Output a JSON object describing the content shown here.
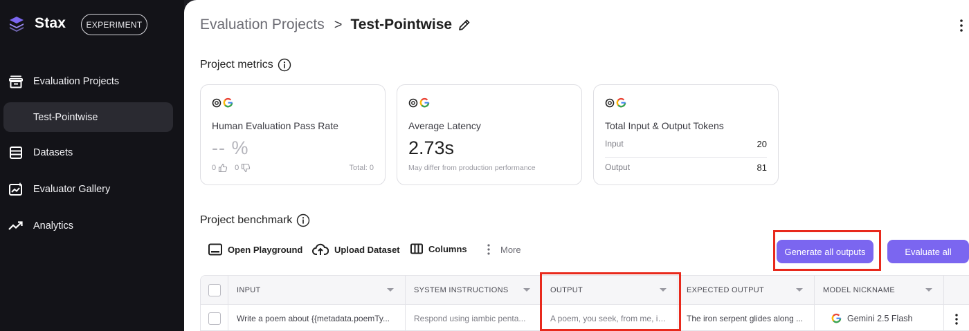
{
  "app": {
    "name": "Stax",
    "badge": "EXPERIMENT"
  },
  "sidebar": {
    "items": [
      {
        "label": "Evaluation Projects",
        "icon": "archive-icon"
      },
      {
        "label": "Test-Pointwise",
        "icon": "",
        "active": true
      },
      {
        "label": "Datasets",
        "icon": "table-icon"
      },
      {
        "label": "Evaluator Gallery",
        "icon": "gallery-chart-icon"
      },
      {
        "label": "Analytics",
        "icon": "trending-up-icon"
      }
    ]
  },
  "breadcrumb": {
    "parent": "Evaluation Projects",
    "separator": ">",
    "current": "Test-Pointwise"
  },
  "metrics": {
    "title": "Project metrics",
    "cards": [
      {
        "title": "Human Evaluation Pass Rate",
        "value": "-- %",
        "thumbs_up": "0",
        "thumbs_down": "0",
        "total": "Total: 0"
      },
      {
        "title": "Average Latency",
        "value": "2.73s",
        "note": "May differ from production performance"
      },
      {
        "title": "Total Input & Output Tokens",
        "rows": [
          {
            "label": "Input",
            "value": "20"
          },
          {
            "label": "Output",
            "value": "81"
          }
        ]
      }
    ]
  },
  "benchmark": {
    "title": "Project benchmark",
    "toolbar": {
      "open_playground": "Open Playground",
      "upload_dataset": "Upload Dataset",
      "columns": "Columns",
      "more": "More",
      "generate_all": "Generate all outputs",
      "evaluate_all": "Evaluate all"
    },
    "columns": [
      "INPUT",
      "SYSTEM INSTRUCTIONS",
      "OUTPUT",
      "EXPECTED OUTPUT",
      "MODEL NICKNAME"
    ],
    "rows": [
      {
        "input": "Write a poem about {{metadata.poemTy...",
        "system_instructions": "Respond using iambic penta...",
        "output": "A poem, you seek, from me, in...",
        "expected_output": "The iron serpent glides along ...",
        "model_nickname": "Gemini 2.5 Flash"
      }
    ]
  },
  "colors": {
    "accent": "#7b66f0",
    "highlight": "#e8291c",
    "sidebar_bg": "#131318"
  }
}
